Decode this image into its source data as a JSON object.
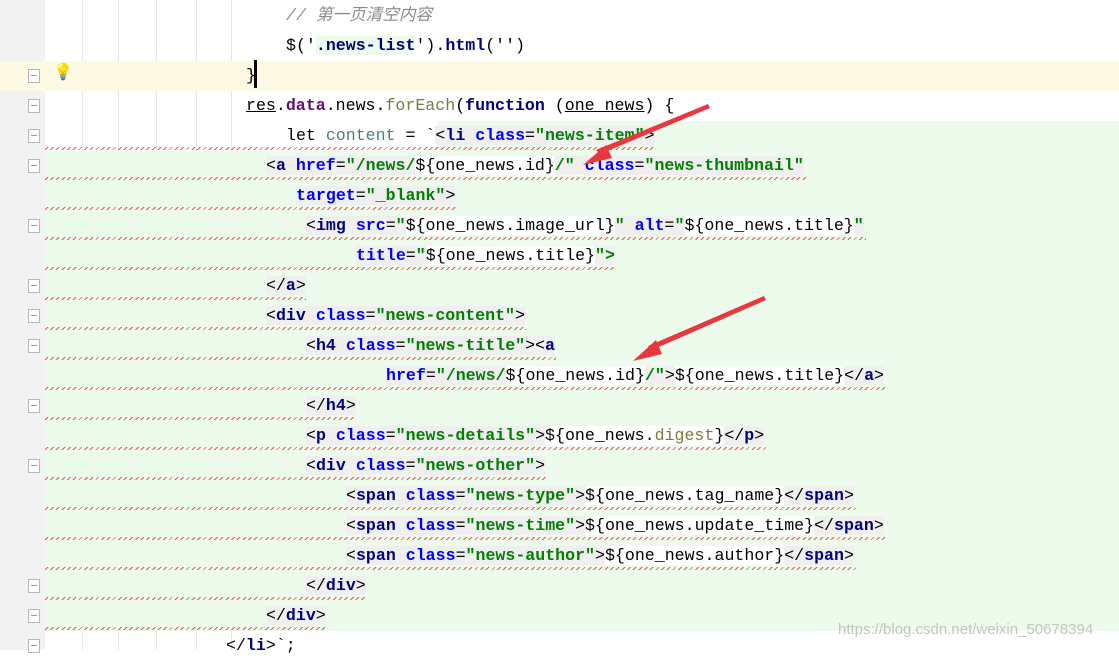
{
  "editor": {
    "lines": [
      [
        [
          "// 第一页清空内容",
          "cm"
        ]
      ],
      [
        [
          "$('",
          "pl"
        ],
        [
          ".news-list",
          "kw lg"
        ],
        [
          "')",
          "pl"
        ],
        [
          ".",
          "pl"
        ],
        [
          "html",
          "kw"
        ],
        [
          "('')",
          "pl"
        ]
      ],
      [
        [
          "}",
          "pl"
        ]
      ],
      [
        [
          "res",
          "pl ul"
        ],
        [
          ".",
          "pl"
        ],
        [
          "data",
          "pr"
        ],
        [
          ".",
          "pl"
        ],
        [
          "news",
          "pl"
        ],
        [
          ".",
          "pl"
        ],
        [
          "forEach",
          "fn"
        ],
        [
          "(",
          "pl"
        ],
        [
          "function",
          "kw"
        ],
        [
          " (",
          "pl"
        ],
        [
          "one_news",
          "pl ul"
        ],
        [
          ") {",
          "pl"
        ]
      ],
      [
        [
          "let ",
          "pl"
        ],
        [
          "content",
          "vr"
        ],
        [
          " = `",
          "pl"
        ],
        [
          "<",
          "pl tg"
        ],
        [
          "li ",
          "kw tg"
        ],
        [
          "class",
          "at tg"
        ],
        [
          "=",
          "pl tg"
        ],
        [
          "\"news-item\"",
          "st tg"
        ],
        [
          ">",
          "pl tg"
        ]
      ],
      [
        [
          "<",
          "pl tg"
        ],
        [
          "a ",
          "kw tg"
        ],
        [
          "href",
          "at tg"
        ],
        [
          "=",
          "pl tg"
        ],
        [
          "\"/news/",
          "st tg"
        ],
        [
          "${one_news.id}",
          "pl wh"
        ],
        [
          "/\" ",
          "st tg"
        ],
        [
          "class",
          "at tg"
        ],
        [
          "=",
          "pl tg"
        ],
        [
          "\"news-thumbnail\"",
          "st tg"
        ]
      ],
      [
        [
          "target",
          "at tg"
        ],
        [
          "=",
          "pl tg"
        ],
        [
          "\"_blank\"",
          "st tg"
        ],
        [
          ">",
          "pl tg"
        ]
      ],
      [
        [
          "<",
          "pl tg"
        ],
        [
          "img ",
          "kw tg"
        ],
        [
          "src",
          "at tg"
        ],
        [
          "=",
          "pl tg"
        ],
        [
          "\"",
          "st tg"
        ],
        [
          "${one_news.image_url}",
          "pl wh"
        ],
        [
          "\" ",
          "st tg"
        ],
        [
          "alt",
          "at tg"
        ],
        [
          "=",
          "pl tg"
        ],
        [
          "\"",
          "st tg"
        ],
        [
          "${one_news.title}",
          "pl wh"
        ],
        [
          "\"",
          "st tg"
        ]
      ],
      [
        [
          "title",
          "at tg"
        ],
        [
          "=",
          "pl tg"
        ],
        [
          "\"",
          "st tg"
        ],
        [
          "${one_news.title}",
          "pl wh"
        ],
        [
          "\">",
          "st tg"
        ]
      ],
      [
        [
          "</",
          "pl tg"
        ],
        [
          "a",
          "kw tg"
        ],
        [
          ">",
          "pl tg"
        ]
      ],
      [
        [
          "<",
          "pl tg"
        ],
        [
          "div ",
          "kw tg"
        ],
        [
          "class",
          "at tg"
        ],
        [
          "=",
          "pl tg"
        ],
        [
          "\"news-content\"",
          "st tg"
        ],
        [
          ">",
          "pl tg"
        ]
      ],
      [
        [
          "<",
          "pl tg"
        ],
        [
          "h4 ",
          "kw tg"
        ],
        [
          "class",
          "at tg"
        ],
        [
          "=",
          "pl tg"
        ],
        [
          "\"news-title\"",
          "st tg"
        ],
        [
          "><",
          "pl tg"
        ],
        [
          "a",
          "kw tg"
        ]
      ],
      [
        [
          "href",
          "at tg"
        ],
        [
          "=",
          "pl tg"
        ],
        [
          "\"/news/",
          "st tg"
        ],
        [
          "${one_news.id}",
          "pl wh"
        ],
        [
          "/\"",
          "st tg"
        ],
        [
          ">",
          "pl tg"
        ],
        [
          "${one_news.title}",
          "pl wh"
        ],
        [
          "</",
          "pl tg"
        ],
        [
          "a",
          "kw tg"
        ],
        [
          ">",
          "pl tg"
        ]
      ],
      [
        [
          "</",
          "pl tg"
        ],
        [
          "h4",
          "kw tg"
        ],
        [
          ">",
          "pl tg"
        ]
      ],
      [
        [
          "<",
          "pl tg"
        ],
        [
          "p ",
          "kw tg"
        ],
        [
          "class",
          "at tg"
        ],
        [
          "=",
          "pl tg"
        ],
        [
          "\"news-details\"",
          "st tg"
        ],
        [
          ">",
          "pl tg"
        ],
        [
          "${one_news.",
          "pl wh"
        ],
        [
          "digest",
          "fn wh"
        ],
        [
          "}",
          "pl wh"
        ],
        [
          "</",
          "pl tg"
        ],
        [
          "p",
          "kw tg"
        ],
        [
          ">",
          "pl tg"
        ]
      ],
      [
        [
          "<",
          "pl tg"
        ],
        [
          "div ",
          "kw tg"
        ],
        [
          "class",
          "at tg"
        ],
        [
          "=",
          "pl tg"
        ],
        [
          "\"news-other\"",
          "st tg"
        ],
        [
          ">",
          "pl tg"
        ]
      ],
      [
        [
          "<",
          "pl tg"
        ],
        [
          "span ",
          "kw tg"
        ],
        [
          "class",
          "at tg"
        ],
        [
          "=",
          "pl tg"
        ],
        [
          "\"news-type\"",
          "st tg"
        ],
        [
          ">",
          "pl tg"
        ],
        [
          "${one_news.tag_name}",
          "pl wh"
        ],
        [
          "</",
          "pl tg"
        ],
        [
          "span",
          "kw tg"
        ],
        [
          ">",
          "pl tg"
        ]
      ],
      [
        [
          "<",
          "pl tg"
        ],
        [
          "span ",
          "kw tg"
        ],
        [
          "class",
          "at tg"
        ],
        [
          "=",
          "pl tg"
        ],
        [
          "\"news-time\"",
          "st tg"
        ],
        [
          ">",
          "pl tg"
        ],
        [
          "${one_news.update_time}",
          "pl wh"
        ],
        [
          "</",
          "pl tg"
        ],
        [
          "span",
          "kw tg"
        ],
        [
          ">",
          "pl tg"
        ]
      ],
      [
        [
          "<",
          "pl tg"
        ],
        [
          "span ",
          "kw tg"
        ],
        [
          "class",
          "at tg"
        ],
        [
          "=",
          "pl tg"
        ],
        [
          "\"news-author\"",
          "st tg"
        ],
        [
          ">",
          "pl tg"
        ],
        [
          "${one_news.author}",
          "pl wh"
        ],
        [
          "</",
          "pl tg"
        ],
        [
          "span",
          "kw tg"
        ],
        [
          ">",
          "pl tg"
        ]
      ],
      [
        [
          "</",
          "pl tg"
        ],
        [
          "div",
          "kw tg"
        ],
        [
          ">",
          "pl tg"
        ]
      ],
      [
        [
          "</",
          "pl tg"
        ],
        [
          "div",
          "kw tg"
        ],
        [
          ">",
          "pl tg"
        ]
      ],
      [
        [
          "</",
          "pl"
        ],
        [
          "li",
          "kw"
        ],
        [
          ">",
          "pl"
        ],
        [
          "`;",
          "pl"
        ]
      ]
    ]
  },
  "annotation_color": "#e8383d",
  "icons": {
    "intention": "lightbulb-icon",
    "fold": "fold-marker-icon"
  },
  "watermark": "https://blog.csdn.net/weixin_50678394"
}
